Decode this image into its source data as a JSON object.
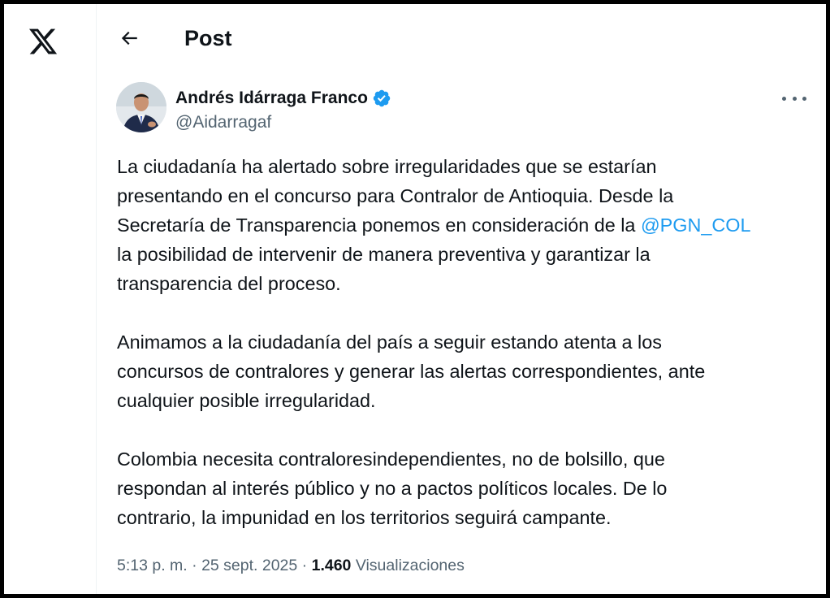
{
  "header": {
    "title": "Post"
  },
  "author": {
    "name": "Andrés Idárraga Franco",
    "handle": "@Aidarragaf"
  },
  "tweet": {
    "para1": {
      "l1": "La ciudadanía ha alertado sobre irregularidades que se estarían",
      "l2": "presentando en el concurso para Contralor de Antioquia. Desde la",
      "l3_pre": "Secretaría de Transparencia ponemos en consideración de la ",
      "l3_mention": "@PGN_COL",
      "l4": "la posibilidad de intervenir de manera preventiva y garantizar la",
      "l5": "transparencia del proceso."
    },
    "para2": {
      "l1": "Animamos a la ciudadanía del país a seguir estando atenta a los",
      "l2": "concursos de contralores y generar las alertas correspondientes, ante",
      "l3": "cualquier posible irregularidad."
    },
    "para3": {
      "l1": "Colombia necesita contraloresindependientes, no de bolsillo, que",
      "l2": "respondan al interés público y no a pactos políticos locales. De lo",
      "l3": "contrario, la impunidad en los territorios seguirá campante."
    }
  },
  "meta": {
    "time": "5:13 p. m.",
    "separator": " · ",
    "date": "25 sept. 2025",
    "views_count": "1.460",
    "views_label": " Visualizaciones"
  },
  "icons": {
    "logo": "x-logo-icon",
    "back": "arrow-left-icon",
    "verified": "verified-badge-icon",
    "more": "more-horizontal-icon"
  },
  "colors": {
    "accent": "#1d9bf0",
    "text": "#0f1419",
    "muted": "#536471",
    "divider": "#eff3f4"
  }
}
